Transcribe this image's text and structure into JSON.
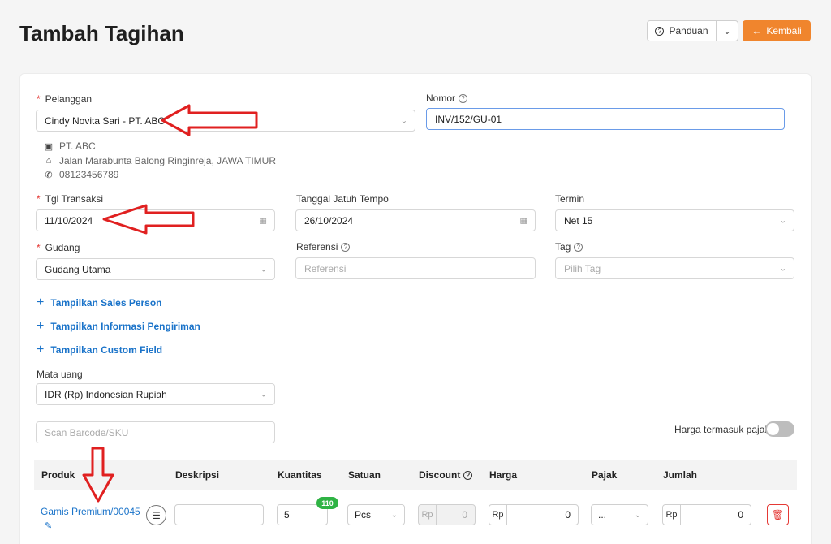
{
  "header": {
    "title": "Tambah Tagihan",
    "panduan_label": "Panduan",
    "kembali_label": "Kembali"
  },
  "form": {
    "pelanggan": {
      "label": "Pelanggan",
      "value": "Cindy Novita Sari - PT. ABC"
    },
    "nomor": {
      "label": "Nomor",
      "value": "INV/152/GU-01"
    },
    "customer_info": {
      "company": "PT. ABC",
      "address": "Jalan Marabunta Balong Ringinreja, JAWA TIMUR",
      "phone": "08123456789"
    },
    "tgl_transaksi": {
      "label": "Tgl Transaksi",
      "value": "11/10/2024"
    },
    "jatuh_tempo": {
      "label": "Tanggal Jatuh Tempo",
      "value": "26/10/2024"
    },
    "termin": {
      "label": "Termin",
      "value": "Net 15"
    },
    "gudang": {
      "label": "Gudang",
      "value": "Gudang Utama"
    },
    "referensi": {
      "label": "Referensi",
      "placeholder": "Referensi"
    },
    "tag": {
      "label": "Tag",
      "placeholder": "Pilih Tag"
    },
    "links": [
      "Tampilkan Sales Person",
      "Tampilkan Informasi Pengiriman",
      "Tampilkan Custom Field"
    ],
    "mata_uang": {
      "label": "Mata uang",
      "value": "IDR (Rp) Indonesian Rupiah"
    },
    "scan": {
      "placeholder": "Scan Barcode/SKU"
    },
    "harga_pajak_label": "Harga termasuk pajak"
  },
  "table": {
    "headers": [
      "Produk",
      "Deskripsi",
      "Kuantitas",
      "Satuan",
      "Discount",
      "Harga",
      "Pajak",
      "Jumlah"
    ],
    "row": {
      "produk": "Gamis Premium/00045",
      "kuantitas": "5",
      "stock_badge": "110",
      "satuan": "Pcs",
      "discount_prefix": "Rp",
      "discount": "0",
      "harga_prefix": "Rp",
      "harga": "0",
      "pajak": "...",
      "jumlah_prefix": "Rp",
      "jumlah": "0"
    }
  },
  "colors": {
    "accent": "#f0852d",
    "link": "#1a73c9",
    "required": "#e53935",
    "annotation": "#e02020"
  }
}
